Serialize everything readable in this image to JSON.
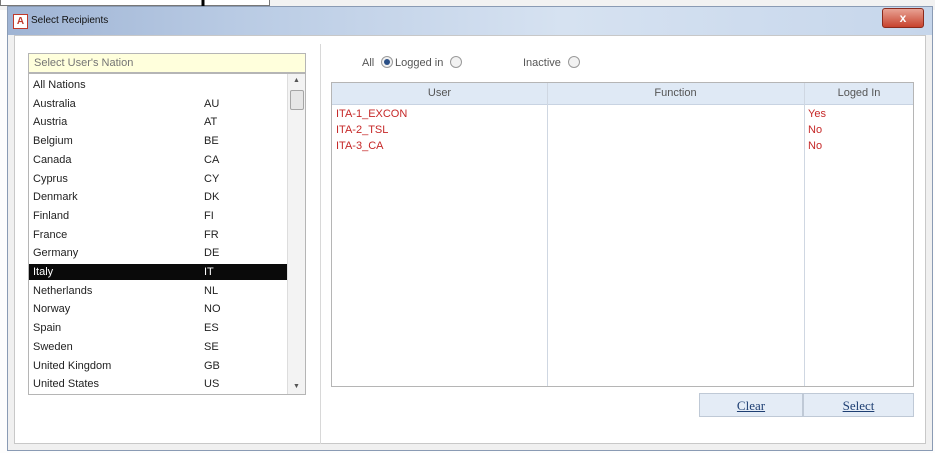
{
  "window": {
    "title": "Select Recipients",
    "app_icon": "A",
    "close_label": "x"
  },
  "nation_search": {
    "placeholder": "Select User's Nation"
  },
  "nations": [
    {
      "name": "All Nations",
      "code": ""
    },
    {
      "name": "Australia",
      "code": "AU"
    },
    {
      "name": "Austria",
      "code": "AT"
    },
    {
      "name": "Belgium",
      "code": "BE"
    },
    {
      "name": "Canada",
      "code": "CA"
    },
    {
      "name": "Cyprus",
      "code": "CY"
    },
    {
      "name": "Denmark",
      "code": "DK"
    },
    {
      "name": "Finland",
      "code": "FI"
    },
    {
      "name": "France",
      "code": "FR"
    },
    {
      "name": "Germany",
      "code": "DE"
    },
    {
      "name": "Italy",
      "code": "IT",
      "selected": true
    },
    {
      "name": "Netherlands",
      "code": "NL"
    },
    {
      "name": "Norway",
      "code": "NO"
    },
    {
      "name": "Spain",
      "code": "ES"
    },
    {
      "name": "Sweden",
      "code": "SE"
    },
    {
      "name": "United Kingdom",
      "code": "GB"
    },
    {
      "name": "United States",
      "code": "US"
    }
  ],
  "filters": [
    {
      "label": "All",
      "checked": true
    },
    {
      "label": "Logged in",
      "checked": false
    },
    {
      "label": "Inactive",
      "checked": false
    }
  ],
  "users_table": {
    "headers": {
      "user": "User",
      "function": "Function",
      "logged_in": "Loged In"
    },
    "rows": [
      {
        "user": "ITA-1_EXCON",
        "function": "",
        "logged_in": "Yes"
      },
      {
        "user": "ITA-2_TSL",
        "function": "",
        "logged_in": "No"
      },
      {
        "user": "ITA-3_CA",
        "function": "",
        "logged_in": "No"
      }
    ]
  },
  "buttons": {
    "clear": "Clear",
    "select": "Select"
  },
  "colors": {
    "selected_row_bg": "#0a0a0a",
    "user_text": "#c62828",
    "search_bg": "#ffffdc",
    "header_bg": "#dfe9f5"
  }
}
